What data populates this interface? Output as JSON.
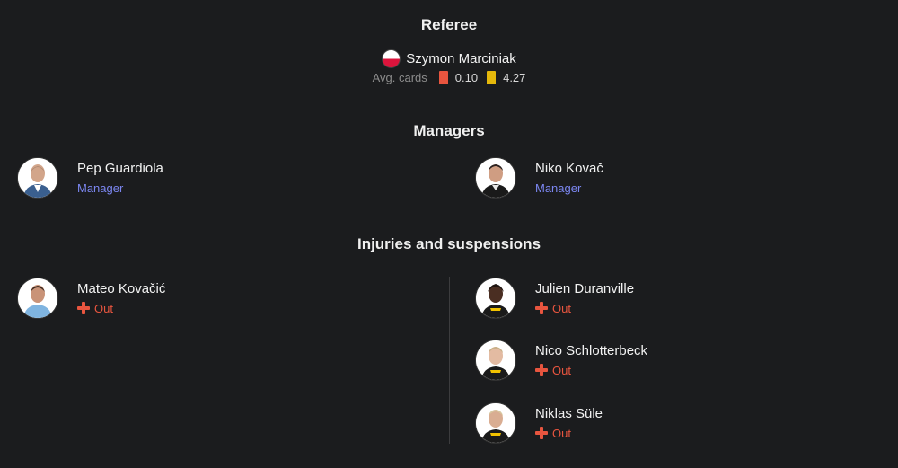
{
  "referee": {
    "title": "Referee",
    "name": "Szymon Marciniak",
    "avg_cards_label": "Avg. cards",
    "red_cards_avg": "0.10",
    "yellow_cards_avg": "4.27"
  },
  "managers": {
    "title": "Managers",
    "home": {
      "name": "Pep Guardiola",
      "role": "Manager"
    },
    "away": {
      "name": "Niko Kovač",
      "role": "Manager"
    }
  },
  "injuries": {
    "title": "Injuries and suspensions",
    "home": [
      {
        "name": "Mateo Kovačić",
        "status": "Out"
      }
    ],
    "away": [
      {
        "name": "Julien Duranville",
        "status": "Out"
      },
      {
        "name": "Nico Schlotterbeck",
        "status": "Out"
      },
      {
        "name": "Niklas Süle",
        "status": "Out"
      }
    ]
  },
  "colors": {
    "background": "#1b1c1e",
    "role_accent": "#7b86f0",
    "status_out": "#e8553f",
    "red_card": "#e8553f",
    "yellow_card": "#e5b80b"
  }
}
